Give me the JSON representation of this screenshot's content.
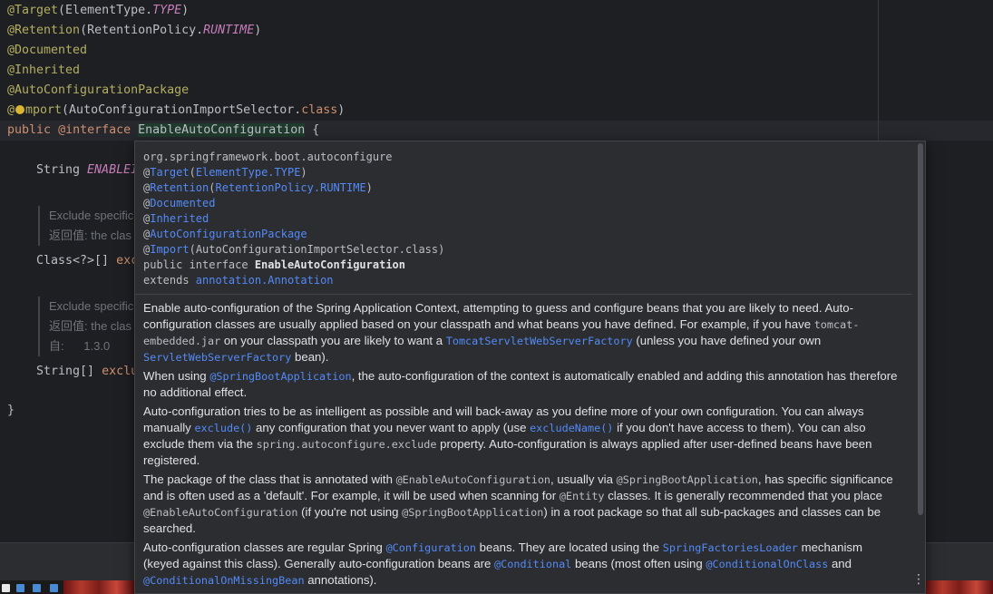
{
  "editor": {
    "line1": {
      "ann": "@Target",
      "open": "(ElementType.",
      "enum": "TYPE",
      "close": ")"
    },
    "line2": {
      "ann": "@Retention",
      "open": "(RetentionPolicy.",
      "enum": "RUNTIME",
      "close": ")"
    },
    "line3": "@Documented",
    "line4": "@Inherited",
    "line5": "@AutoConfigurationPackage",
    "line6": {
      "at": "@",
      "ann": "mport",
      "open": "(AutoConfigurationImportSelector.",
      "kw": "class",
      "close": ")"
    },
    "line7": {
      "kw1": "public",
      "kw2": "@interface",
      "name": "EnableAutoConfiguration",
      "brace": "{"
    },
    "field1": {
      "type": "String ",
      "name": "ENABLEI"
    },
    "doc1": {
      "line1": "Exclude specific",
      "line2": "返回值: the clas"
    },
    "field2": {
      "type": "Class<?>[] ",
      "name": "exc"
    },
    "doc2": {
      "line1": "Exclude specific",
      "line2": "返回值: the clas",
      "since_label": "自:",
      "since_value": "1.3.0"
    },
    "field3": {
      "type": "String[] ",
      "name": "exclu"
    },
    "close": "}"
  },
  "popup": {
    "package": "org.springframework.boot.autoconfigure",
    "ann_target": {
      "at": "@",
      "name": "Target",
      "arg": "ElementType.TYPE"
    },
    "ann_retention": {
      "at": "@",
      "name": "Retention",
      "arg": "RetentionPolicy.RUNTIME"
    },
    "ann_documented": {
      "at": "@",
      "name": "Documented"
    },
    "ann_inherited": {
      "at": "@",
      "name": "Inherited"
    },
    "ann_package": {
      "at": "@",
      "name": "AutoConfigurationPackage"
    },
    "ann_import": {
      "at": "@",
      "name": "Import",
      "arg": "(AutoConfigurationImportSelector.class)"
    },
    "decl": {
      "prefix": "public interface ",
      "name": "EnableAutoConfiguration"
    },
    "extends": {
      "prefix": "extends ",
      "link": "annotation.Annotation"
    },
    "p1": {
      "t1": "Enable auto-configuration of the Spring Application Context, attempting to guess and configure beans that you are likely to need. Auto-configuration classes are usually applied based on your classpath and what beans you have defined. For example, if you have ",
      "c1": "tomcat-embedded.jar",
      "t2": " on your classpath you are likely to want a ",
      "l1": "TomcatServletWebServerFactory",
      "t3": " (unless you have defined your own ",
      "l2": "ServletWebServerFactory",
      "t4": " bean)."
    },
    "p2": {
      "t1": "When using ",
      "l1": "@SpringBootApplication",
      "t2": ", the auto-configuration of the context is automatically enabled and adding this annotation has therefore no additional effect."
    },
    "p3": {
      "t1": "Auto-configuration tries to be as intelligent as possible and will back-away as you define more of your own configuration. You can always manually ",
      "l1": "exclude()",
      "t2": " any configuration that you never want to apply (use ",
      "l2": "excludeName()",
      "t3": " if you don't have access to them). You can also exclude them via the ",
      "c1": "spring.autoconfigure.exclude",
      "t4": " property. Auto-configuration is always applied after user-defined beans have been registered."
    },
    "p4": {
      "t1": "The package of the class that is annotated with ",
      "c1": "@EnableAutoConfiguration",
      "t2": ", usually via ",
      "c2": "@SpringBootApplication",
      "t3": ", has specific significance and is often used as a 'default'. For example, it will be used when scanning for ",
      "c3": "@Entity",
      "t4": " classes. It is generally recommended that you place ",
      "c4": "@EnableAutoConfiguration",
      "t5": " (if you're not using ",
      "c5": "@SpringBootApplication",
      "t6": ") in a root package so that all sub-packages and classes can be searched."
    },
    "p5": {
      "t1": "Auto-configuration classes are regular Spring ",
      "l1": "@Configuration",
      "t2": " beans. They are located using the ",
      "l2": "SpringFactoriesLoader",
      "t3": " mechanism (keyed against this class). Generally auto-configuration beans are ",
      "l3": "@Conditional",
      "t4": " beans (most often using ",
      "l4": "@ConditionalOnClass",
      "t5": " and ",
      "l5": "@ConditionalOnMissingBean",
      "t6": " annotations)."
    },
    "more_icon": "⋮"
  }
}
